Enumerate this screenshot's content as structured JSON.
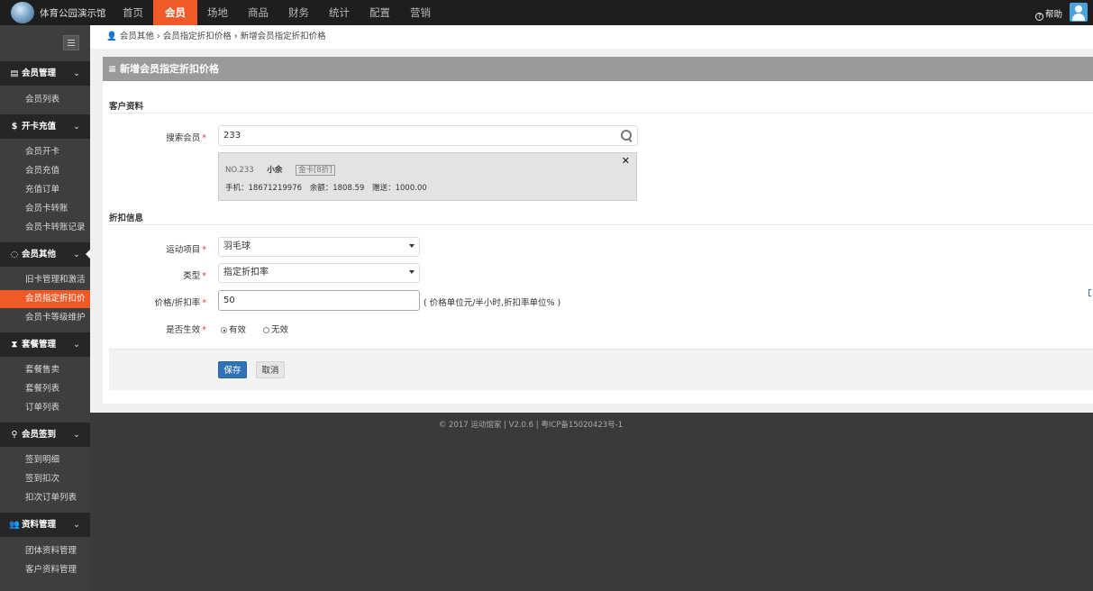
{
  "brand": {
    "title": "体育公园演示馆"
  },
  "nav": {
    "items": [
      "首页",
      "会员",
      "场地",
      "商品",
      "财务",
      "统计",
      "配置",
      "营销"
    ],
    "active": "会员",
    "help": "帮助"
  },
  "sidebar": {
    "groups": [
      {
        "icon": "id-card-icon",
        "title": "会员管理",
        "items": [
          "会员列表"
        ]
      },
      {
        "icon": "dollar-icon",
        "title": "开卡充值",
        "items": [
          "会员开卡",
          "会员充值",
          "充值订单",
          "会员卡转账",
          "会员卡转账记录"
        ]
      },
      {
        "icon": "circle-notch-icon",
        "title": "会员其他",
        "items": [
          "旧卡管理和激活",
          "会员指定折扣价",
          "会员卡等级维护"
        ]
      },
      {
        "icon": "hourglass-icon",
        "title": "套餐管理",
        "items": [
          "套餐售卖",
          "套餐列表",
          "订单列表"
        ]
      },
      {
        "icon": "map-pin-icon",
        "title": "会员签到",
        "items": [
          "签到明细",
          "签到扣次",
          "扣次订单列表"
        ]
      },
      {
        "icon": "users-icon",
        "title": "资料管理",
        "items": [
          "团体资料管理",
          "客户资料管理"
        ]
      }
    ],
    "active_item": "会员指定折扣价"
  },
  "breadcrumb": {
    "icon": "user-icon",
    "items": [
      "会员其他",
      "会员指定折扣价格",
      "新增会员指定折扣价格"
    ],
    "separator": "›"
  },
  "panel": {
    "title": "新增会员指定折扣价格",
    "section_customer": "客户资料",
    "search_label": "搜索会员",
    "search_value": "233",
    "member": {
      "no": "NO.233",
      "name": "小余",
      "card": "金卡[8折]",
      "phone_label": "手机：",
      "phone": "18671219976",
      "balance_label": "余额：",
      "balance": "1808.59",
      "gift_label": "赠送：",
      "gift": "1000.00"
    },
    "section_discount": "折扣信息",
    "sport_label": "运动项目",
    "sport_value": "羽毛球",
    "type_label": "类型",
    "type_value": "指定折扣率",
    "price_label": "价格/折扣率",
    "price_value": "50",
    "price_hint": "( 价格单位元/半小时,折扣率单位% )",
    "valid_label": "是否生效",
    "valid_yes": "有效",
    "valid_no": "无效",
    "valid_selected": "有效",
    "save": "保存",
    "cancel": "取消"
  },
  "footer": {
    "text": "© 2017 运动馆家 | V2.0.6 | 粤ICP备15020423号-1"
  },
  "colors": {
    "accent": "#ef5a28",
    "primary": "#2f72b5",
    "topbar": "#1e1e1e",
    "sidebar": "#3e3e3e"
  }
}
